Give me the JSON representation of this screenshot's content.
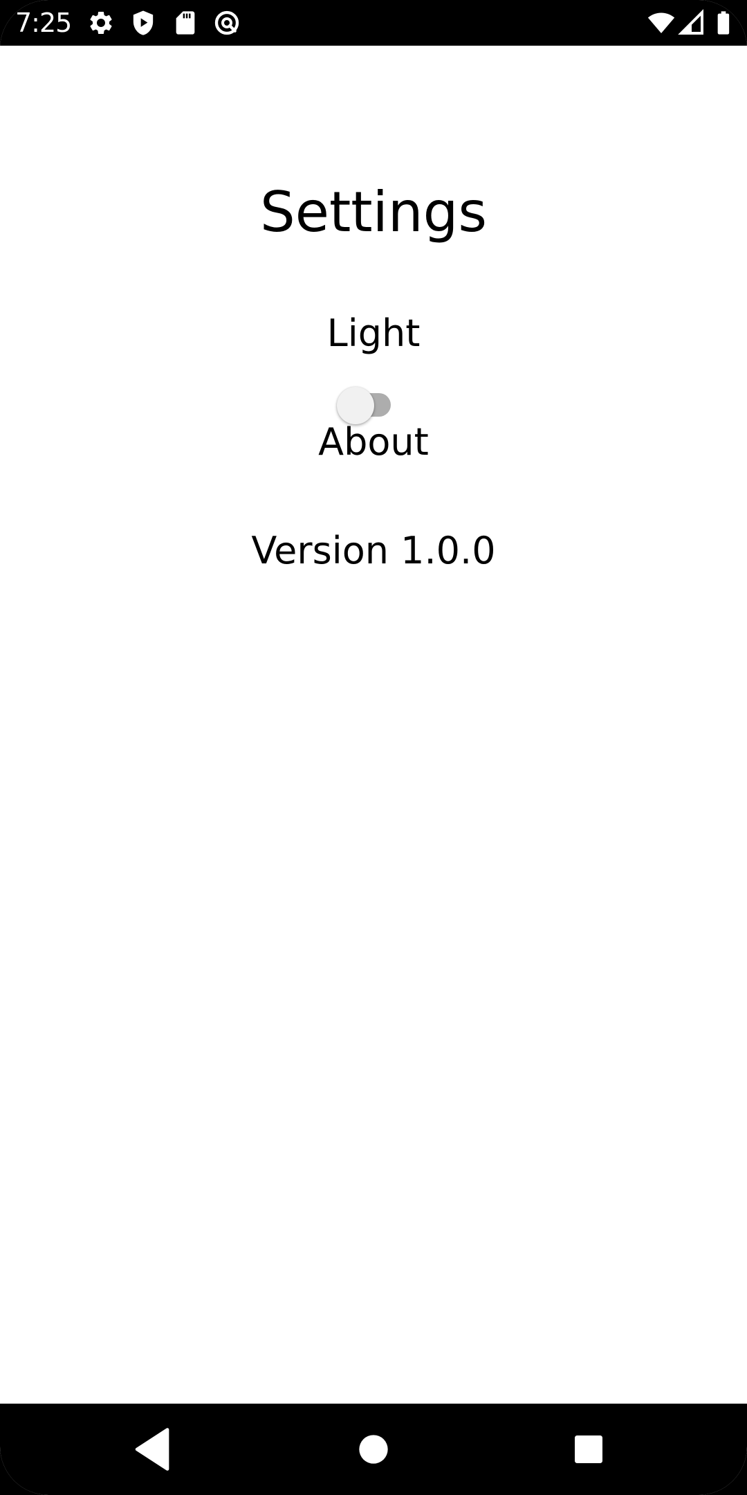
{
  "status_bar": {
    "time": "7:25",
    "left_icons": [
      "gear-icon",
      "shield-play-icon",
      "sd-card-icon",
      "at-sign-icon"
    ],
    "right_icons": [
      "wifi-icon",
      "cellular-signal-icon",
      "battery-icon"
    ]
  },
  "settings": {
    "title": "Settings",
    "theme_label": "Light",
    "theme_switch_on": false,
    "about_label": "About",
    "version": "Version 1.0.0"
  },
  "nav_bar": {
    "buttons": [
      "back-icon",
      "home-icon",
      "recents-icon"
    ]
  },
  "colors": {
    "system_bars": "#000000",
    "background": "#ffffff",
    "text": "#000000",
    "switch_track": "#adadad",
    "switch_thumb": "#f1f1f1"
  }
}
